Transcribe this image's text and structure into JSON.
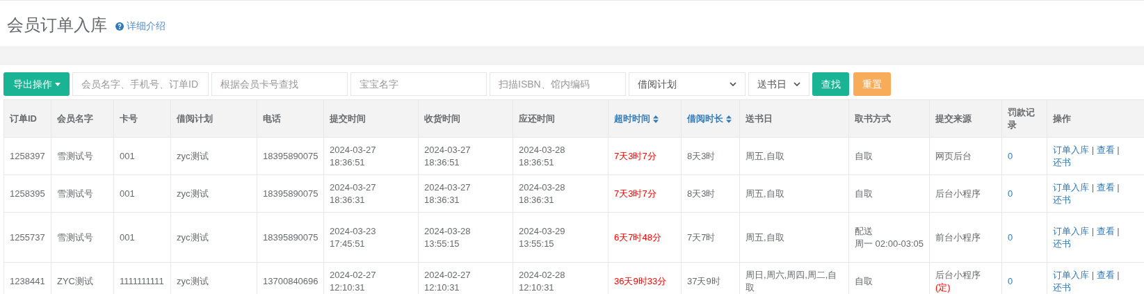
{
  "page_title": "会员订单入库",
  "help_link": "详细介绍",
  "toolbar": {
    "export_button": "导出操作",
    "fields": [
      {
        "placeholder": "会员名字、手机号、订单ID"
      },
      {
        "placeholder": "根据会员卡号查找"
      },
      {
        "placeholder": "宝宝名字"
      },
      {
        "placeholder": "扫描ISBN、馆内编码"
      }
    ],
    "selects": [
      {
        "value": "借阅计划"
      },
      {
        "value": "送书日"
      }
    ],
    "search_button": "查找",
    "reset_button": "重置"
  },
  "table": {
    "separator": "|",
    "columns": [
      {
        "label": "订单ID",
        "kind": "text",
        "sortable": false
      },
      {
        "label": "会员名字",
        "kind": "text",
        "sortable": false
      },
      {
        "label": "卡号",
        "kind": "text",
        "sortable": false
      },
      {
        "label": "借阅计划",
        "kind": "text",
        "sortable": false
      },
      {
        "label": "电话",
        "kind": "text",
        "sortable": false
      },
      {
        "label": "提交时间",
        "kind": "text",
        "sortable": false
      },
      {
        "label": "收货时间",
        "kind": "text",
        "sortable": false
      },
      {
        "label": "应还时间",
        "kind": "text",
        "sortable": false
      },
      {
        "label": "超时时间",
        "kind": "overdue",
        "sortable": true
      },
      {
        "label": "借阅时长",
        "kind": "text",
        "sortable": true
      },
      {
        "label": "送书日",
        "kind": "text",
        "sortable": false
      },
      {
        "label": "取书方式",
        "kind": "text",
        "sortable": false
      },
      {
        "label": "提交来源",
        "kind": "source",
        "sortable": false
      },
      {
        "label": "罚款记录",
        "kind": "fine",
        "sortable": false
      },
      {
        "label": "操作",
        "kind": "actions",
        "sortable": false
      }
    ],
    "rows": [
      {
        "cells": [
          "1258397",
          "雪测试号",
          "001",
          "zyc测试",
          "18395890075",
          [
            "2024-03-27",
            "18:36:51"
          ],
          [
            "2024-03-27",
            "18:36:51"
          ],
          [
            "2024-03-28",
            "18:36:51"
          ],
          "7天3时7分",
          "8天3时",
          "周五,自取",
          "自取",
          {
            "text": "网页后台"
          },
          "0",
          [
            "订单入库",
            "查看",
            "还书"
          ]
        ]
      },
      {
        "cells": [
          "1258395",
          "雪测试号",
          "001",
          "zyc测试",
          "18395890075",
          [
            "2024-03-27",
            "18:36:31"
          ],
          [
            "2024-03-27",
            "18:36:31"
          ],
          [
            "2024-03-28",
            "18:36:31"
          ],
          "7天3时7分",
          "8天3时",
          "周五,自取",
          "自取",
          {
            "text": "后台小程序"
          },
          "0",
          [
            "订单入库",
            "查看",
            "还书"
          ]
        ]
      },
      {
        "cells": [
          "1255737",
          "雪测试号",
          "001",
          "zyc测试",
          "18395890075",
          [
            "2024-03-23",
            "17:45:51"
          ],
          [
            "2024-03-28",
            "13:55:15"
          ],
          [
            "2024-03-29",
            "13:55:15"
          ],
          "6天7时48分",
          "7天7时",
          "周五,自取",
          [
            "配送",
            "周一 02:00-03:05"
          ],
          {
            "text": "前台小程序"
          },
          "0",
          [
            "订单入库",
            "查看",
            "还书"
          ]
        ]
      },
      {
        "cells": [
          "1238441",
          "ZYC测试",
          "1111111111",
          "zyc测试",
          "13700840696",
          [
            "2024-02-27",
            "12:10:31"
          ],
          [
            "2024-02-27",
            "12:10:31"
          ],
          [
            "2024-02-28",
            "12:10:31"
          ],
          "36天9时33分",
          "37天9时",
          "周日,周六,周四,周二,自取",
          "自取",
          {
            "text": "后台小程序",
            "tag": "(定)"
          },
          "0",
          [
            "订单入库",
            "查看",
            "还书"
          ]
        ]
      }
    ]
  }
}
